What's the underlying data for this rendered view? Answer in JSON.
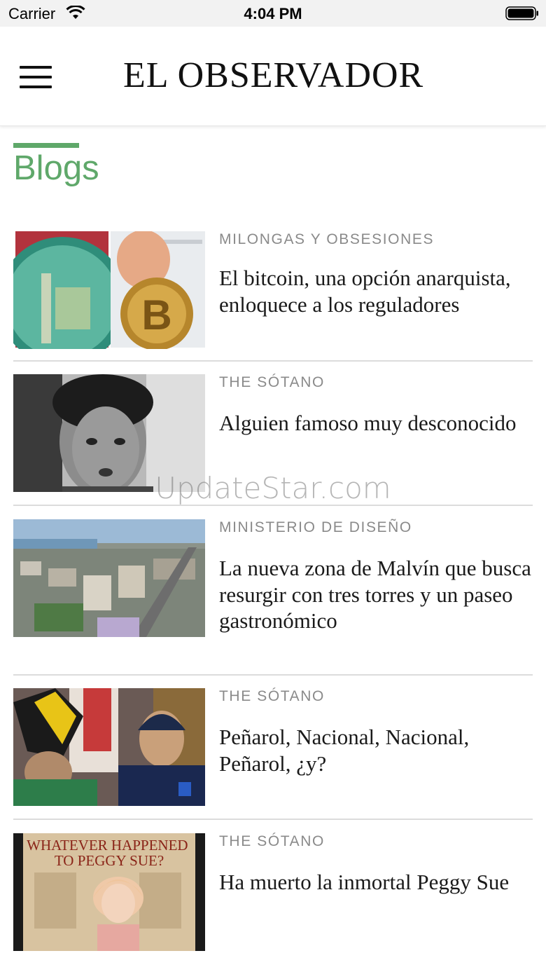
{
  "status_bar": {
    "carrier": "Carrier",
    "time": "4:04 PM"
  },
  "header": {
    "logo": "EL OBSERVADOR"
  },
  "section": {
    "title": "Blogs"
  },
  "articles": [
    {
      "category": "MILONGAS Y OBSESIONES",
      "title": "El bitcoin, una opción anarquista, enloquece a los reguladores"
    },
    {
      "category": "THE SÓTANO",
      "title": "Alguien famoso muy desconocido"
    },
    {
      "category": "MINISTERIO DE DISEÑO",
      "title": "La nueva zona de Malvín que busca resurgir con tres torres y un paseo gastronómico"
    },
    {
      "category": "THE SÓTANO",
      "title": "Peñarol, Nacional, Nacional, Peñarol, ¿y?"
    },
    {
      "category": "THE SÓTANO",
      "title": "Ha muerto la inmortal Peggy Sue",
      "image_text": "WHATEVER HAPPENED TO PEGGY SUE?"
    }
  ],
  "watermark": "UpdateStar.com",
  "colors": {
    "accent": "#5fa86a",
    "divider": "#dcdcdc",
    "category": "#8a8a8a"
  }
}
